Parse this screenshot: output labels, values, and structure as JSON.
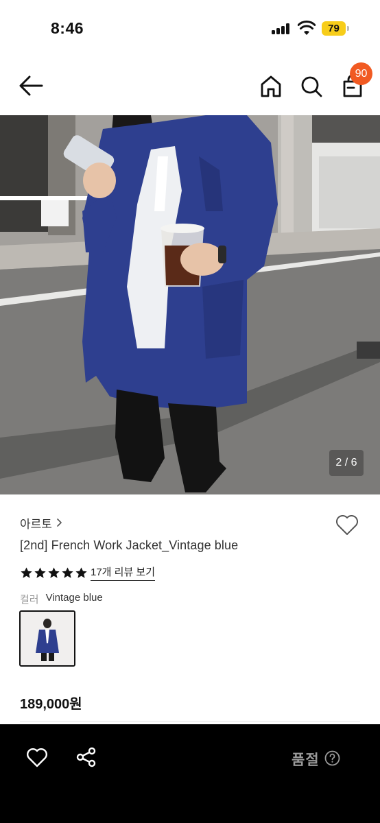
{
  "status_bar": {
    "time": "8:46",
    "battery": "79"
  },
  "header": {
    "cart_count": "90"
  },
  "icons": {
    "back": "arrow-left-icon",
    "home": "home-icon",
    "search": "search-icon",
    "cart": "shopping-bag-icon",
    "wishlist": "heart-outline-icon",
    "share": "share-icon",
    "help": "question-circle-icon"
  },
  "gallery": {
    "counter": "2 / 6"
  },
  "product": {
    "brand": "아르토",
    "title": "[2nd] French Work Jacket_Vintage blue",
    "rating_stars": 5,
    "review_link": "17개 리뷰 보기",
    "color_label": "컬러",
    "color_value": "Vintage blue",
    "price": "189,000원"
  },
  "bottom_bar": {
    "status_label": "품절"
  },
  "colors": {
    "badge": "#f15a22",
    "battery": "#f7cd1a",
    "jacket": "#2e3f8f",
    "bottom_bar": "#000000",
    "soldout_text": "#9a9a9a"
  }
}
